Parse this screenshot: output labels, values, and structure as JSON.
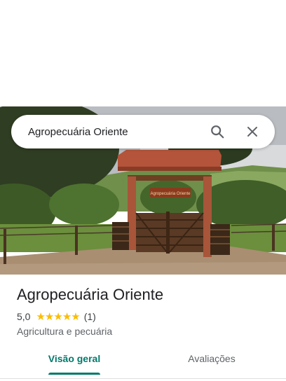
{
  "search": {
    "query": "Agropecuária Oriente",
    "search_icon": "search-icon",
    "close_icon": "close-icon"
  },
  "hero": {
    "sign_text": "Agropecuária Oriente"
  },
  "place": {
    "name": "Agropecuária Oriente",
    "rating": "5,0",
    "rating_value": 5,
    "review_count": "(1)",
    "category": "Agricultura e pecuária"
  },
  "tabs": [
    {
      "label": "Visão geral",
      "active": true
    },
    {
      "label": "Avaliações",
      "active": false
    }
  ],
  "colors": {
    "accent": "#00796b",
    "star": "#fbbc04"
  }
}
